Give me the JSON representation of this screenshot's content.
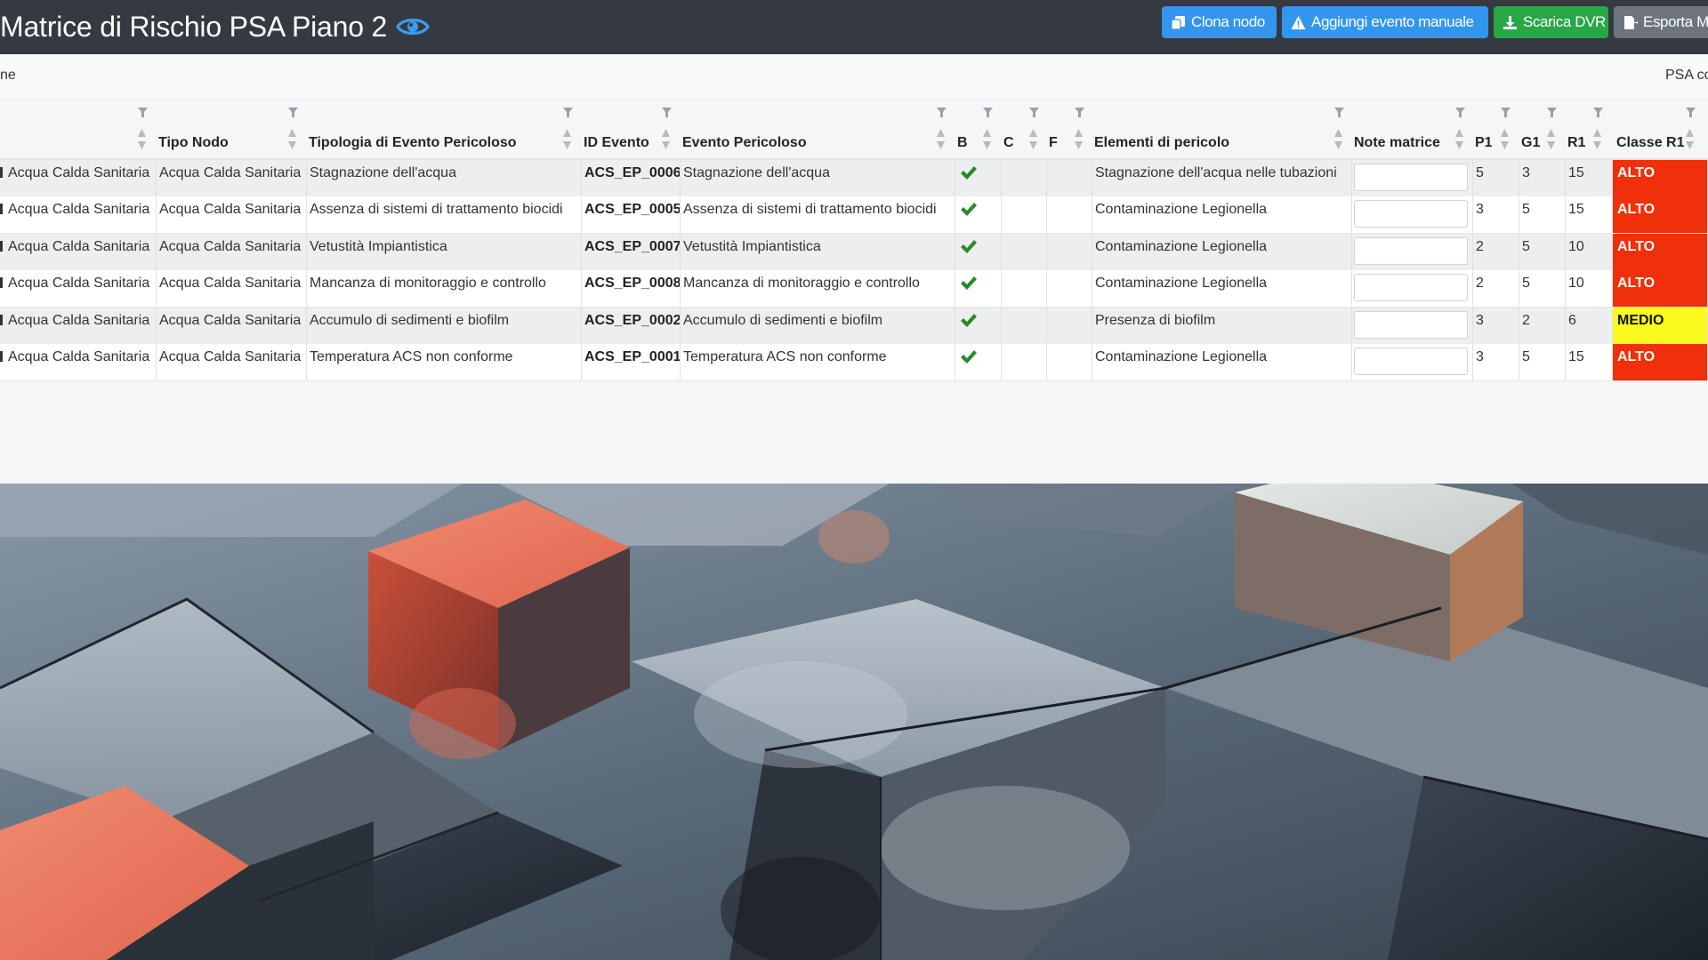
{
  "header": {
    "title": "Matrice di Rischio PSA Piano 2",
    "buttons": {
      "clone": "Clona nodo",
      "add_event": "Aggiungi evento manuale",
      "download_dvr": "Scarica DVR",
      "export": "Esporta M"
    }
  },
  "subbar": {
    "left_text": "ne",
    "right_text": "PSA co"
  },
  "table": {
    "columns": [
      "",
      "Tipo Nodo",
      "Tipologia di Evento Pericoloso",
      "ID Evento",
      "Evento Pericoloso",
      "B",
      "C",
      "F",
      "Elementi di pericolo",
      "Note matrice",
      "P1",
      "G1",
      "R1",
      "Classe R1"
    ],
    "rows": [
      {
        "nodo": "Acqua Calda Sanitaria",
        "tipo_nodo": "Acqua Calda Sanitaria",
        "tipologia": "Stagnazione dell'acqua",
        "id": "ACS_EP_0006",
        "evento": "Stagnazione dell'acqua",
        "b": true,
        "c": "",
        "f": "",
        "elementi": "Stagnazione dell'acqua nelle tubazioni",
        "note": "",
        "p1": "5",
        "g1": "3",
        "r1": "15",
        "classe": "ALTO"
      },
      {
        "nodo": "Acqua Calda Sanitaria",
        "tipo_nodo": "Acqua Calda Sanitaria",
        "tipologia": "Assenza di sistemi di trattamento biocidi",
        "id": "ACS_EP_0005",
        "evento": "Assenza di sistemi di trattamento biocidi",
        "b": true,
        "c": "",
        "f": "",
        "elementi": "Contaminazione Legionella",
        "note": "",
        "p1": "3",
        "g1": "5",
        "r1": "15",
        "classe": "ALTO"
      },
      {
        "nodo": "Acqua Calda Sanitaria",
        "tipo_nodo": "Acqua Calda Sanitaria",
        "tipologia": "Vetustità Impiantistica",
        "id": "ACS_EP_0007",
        "evento": "Vetustità Impiantistica",
        "b": true,
        "c": "",
        "f": "",
        "elementi": "Contaminazione Legionella",
        "note": "",
        "p1": "2",
        "g1": "5",
        "r1": "10",
        "classe": "ALTO"
      },
      {
        "nodo": "Acqua Calda Sanitaria",
        "tipo_nodo": "Acqua Calda Sanitaria",
        "tipologia": "Mancanza di monitoraggio e controllo",
        "id": "ACS_EP_0008",
        "evento": "Mancanza di monitoraggio e controllo",
        "b": true,
        "c": "",
        "f": "",
        "elementi": "Contaminazione Legionella",
        "note": "",
        "p1": "2",
        "g1": "5",
        "r1": "10",
        "classe": "ALTO"
      },
      {
        "nodo": "Acqua Calda Sanitaria",
        "tipo_nodo": "Acqua Calda Sanitaria",
        "tipologia": "Accumulo di sedimenti e biofilm",
        "id": "ACS_EP_0002",
        "evento": "Accumulo di sedimenti e biofilm",
        "b": true,
        "c": "",
        "f": "",
        "elementi": "Presenza di biofilm",
        "note": "",
        "p1": "3",
        "g1": "2",
        "r1": "6",
        "classe": "MEDIO"
      },
      {
        "nodo": "Acqua Calda Sanitaria",
        "tipo_nodo": "Acqua Calda Sanitaria",
        "tipologia": "Temperatura ACS non conforme",
        "id": "ACS_EP_0001",
        "evento": "Temperatura ACS non conforme",
        "b": true,
        "c": "",
        "f": "",
        "elementi": "Contaminazione Legionella",
        "note": "",
        "p1": "3",
        "g1": "5",
        "r1": "15",
        "classe": "ALTO"
      }
    ]
  },
  "colors": {
    "header_bg": "#343a40",
    "primary": "#3396ee",
    "success": "#28a745",
    "secondary": "#6c757d",
    "risk_high": "#f0300a",
    "risk_medium": "#fafa1e",
    "check": "#2a8a2a"
  },
  "icons": {
    "title": "eye-icon",
    "clone": "copy-icon",
    "add_event": "warning-icon",
    "download_dvr": "download-icon",
    "export": "export-file-icon",
    "column_filter": "filter-icon",
    "column_sort": "sort-icon",
    "flag": "check-icon"
  }
}
